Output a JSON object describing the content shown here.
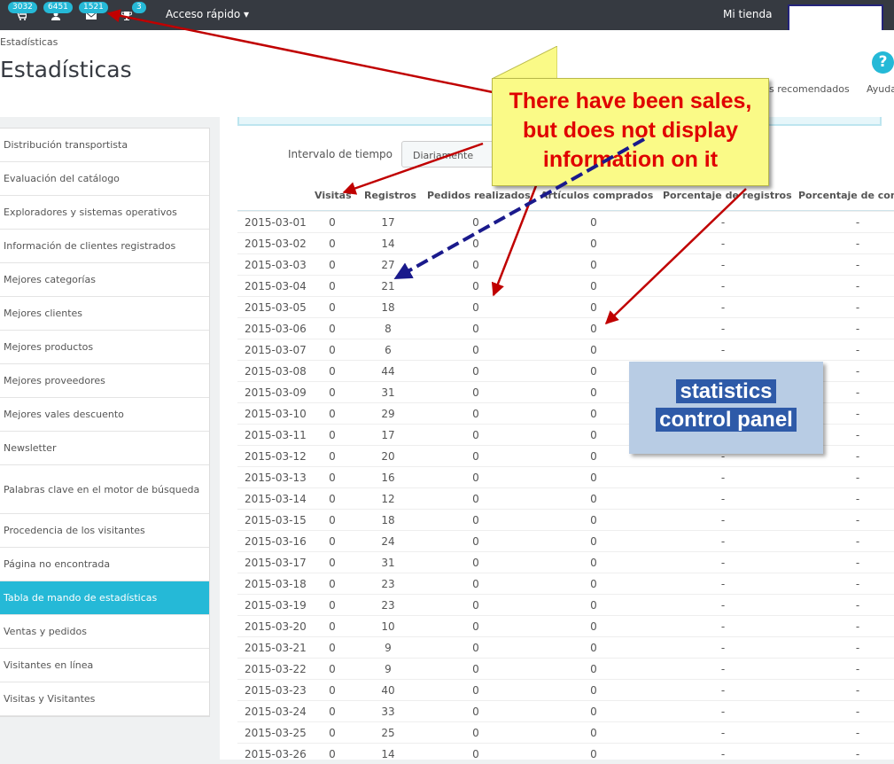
{
  "topbar": {
    "badges": [
      "3032",
      "6451",
      "1521",
      "3"
    ],
    "quick_access": "Acceso rápido ▾",
    "shop_label": "Mi tienda",
    "icons": [
      "cart-icon",
      "user-icon",
      "envelope-icon",
      "trophy-icon"
    ]
  },
  "header": {
    "breadcrumb": "Estadísticas",
    "title": "Estadísticas",
    "recommended": "s recomendados",
    "help": "Ayuda",
    "help_icon": "?"
  },
  "sidebar": {
    "items": [
      "Distribución transportista",
      "Evaluación del catálogo",
      "Exploradores y sistemas operativos",
      "Información de clientes registrados",
      "Mejores categorías",
      "Mejores clientes",
      "Mejores productos",
      "Mejores proveedores",
      "Mejores vales descuento",
      "Newsletter",
      "Palabras clave en el motor de búsqueda",
      "Procedencia de los visitantes",
      "Página no encontrada",
      "Tabla de mando de estadísticas",
      "Ventas y pedidos",
      "Visitantes en línea",
      "Visitas y Visitantes"
    ],
    "active_index": 13
  },
  "filter": {
    "label": "Intervalo de tiempo",
    "value": "Diariamente"
  },
  "table": {
    "headers": [
      "Visitas",
      "Registros",
      "Pedidos realizados",
      "Artículos comprados",
      "Porcentaje de registros",
      "Porcentaje de com"
    ],
    "rows": [
      [
        "2015-03-01",
        "0",
        "17",
        "0",
        "0",
        "-",
        "-"
      ],
      [
        "2015-03-02",
        "0",
        "14",
        "0",
        "0",
        "-",
        "-"
      ],
      [
        "2015-03-03",
        "0",
        "27",
        "0",
        "0",
        "-",
        "-"
      ],
      [
        "2015-03-04",
        "0",
        "21",
        "0",
        "0",
        "-",
        "-"
      ],
      [
        "2015-03-05",
        "0",
        "18",
        "0",
        "0",
        "-",
        "-"
      ],
      [
        "2015-03-06",
        "0",
        "8",
        "0",
        "0",
        "-",
        "-"
      ],
      [
        "2015-03-07",
        "0",
        "6",
        "0",
        "0",
        "-",
        "-"
      ],
      [
        "2015-03-08",
        "0",
        "44",
        "0",
        "0",
        "-",
        "-"
      ],
      [
        "2015-03-09",
        "0",
        "31",
        "0",
        "0",
        "-",
        "-"
      ],
      [
        "2015-03-10",
        "0",
        "29",
        "0",
        "0",
        "-",
        "-"
      ],
      [
        "2015-03-11",
        "0",
        "17",
        "0",
        "0",
        "-",
        "-"
      ],
      [
        "2015-03-12",
        "0",
        "20",
        "0",
        "0",
        "-",
        "-"
      ],
      [
        "2015-03-13",
        "0",
        "16",
        "0",
        "0",
        "-",
        "-"
      ],
      [
        "2015-03-14",
        "0",
        "12",
        "0",
        "0",
        "-",
        "-"
      ],
      [
        "2015-03-15",
        "0",
        "18",
        "0",
        "0",
        "-",
        "-"
      ],
      [
        "2015-03-16",
        "0",
        "24",
        "0",
        "0",
        "-",
        "-"
      ],
      [
        "2015-03-17",
        "0",
        "31",
        "0",
        "0",
        "-",
        "-"
      ],
      [
        "2015-03-18",
        "0",
        "23",
        "0",
        "0",
        "-",
        "-"
      ],
      [
        "2015-03-19",
        "0",
        "23",
        "0",
        "0",
        "-",
        "-"
      ],
      [
        "2015-03-20",
        "0",
        "10",
        "0",
        "0",
        "-",
        "-"
      ],
      [
        "2015-03-21",
        "0",
        "9",
        "0",
        "0",
        "-",
        "-"
      ],
      [
        "2015-03-22",
        "0",
        "9",
        "0",
        "0",
        "-",
        "-"
      ],
      [
        "2015-03-23",
        "0",
        "40",
        "0",
        "0",
        "-",
        "-"
      ],
      [
        "2015-03-24",
        "0",
        "33",
        "0",
        "0",
        "-",
        "-"
      ],
      [
        "2015-03-25",
        "0",
        "25",
        "0",
        "0",
        "-",
        "-"
      ],
      [
        "2015-03-26",
        "0",
        "14",
        "0",
        "0",
        "-",
        "-"
      ]
    ]
  },
  "annotations": {
    "callout_lines": [
      "There have been sales,",
      "but does not display",
      "information on it"
    ],
    "panel_lines": [
      "statistics",
      "control panel"
    ]
  },
  "colors": {
    "topbar": "#363a41",
    "accent": "#25b9d7",
    "callout_bg": "#fafa87",
    "callout_text": "#e00000",
    "annotation_arrow": "#c00000",
    "dashed_arrow": "#1a1a8c"
  }
}
